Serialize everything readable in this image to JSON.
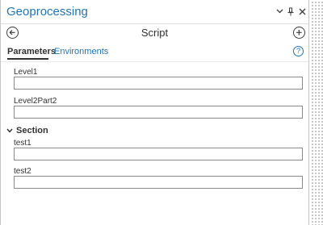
{
  "pane": {
    "title": "Geoprocessing",
    "header_icons": [
      "chevron-down-icon",
      "pin-icon",
      "close-icon"
    ]
  },
  "tool": {
    "title": "Script",
    "back_icon": "arrow-left-circle-icon",
    "add_icon": "plus-circle-icon"
  },
  "tabs": [
    {
      "label": "Parameters",
      "active": true
    },
    {
      "label": "Environments",
      "active": false
    }
  ],
  "help_icon": "question-circle-icon",
  "help_glyph": "?",
  "params": [
    {
      "label": "Level1",
      "value": ""
    },
    {
      "label": "Level2Part2",
      "value": ""
    }
  ],
  "section": {
    "label": "Section",
    "expanded": true,
    "params": [
      {
        "label": "test1",
        "value": ""
      },
      {
        "label": "test2",
        "value": ""
      }
    ]
  },
  "colors": {
    "accent": "#1f75b7",
    "text": "#323232",
    "input_border": "#8a8a8a"
  }
}
